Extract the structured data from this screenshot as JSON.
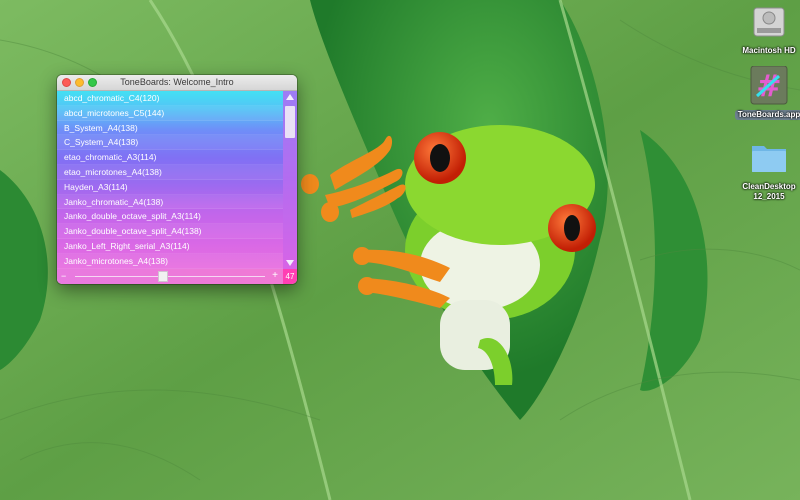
{
  "window": {
    "title": "ToneBoards: Welcome_Intro",
    "items": [
      "abcd_chromatic_C4(120)",
      "abcd_microtones_C5(144)",
      "B_System_A4(138)",
      "C_System_A4(138)",
      "etao_chromatic_A3(114)",
      "etao_microtones_A4(138)",
      "Hayden_A3(114)",
      "Janko_chromatic_A4(138)",
      "Janko_double_octave_split_A3(114)",
      "Janko_double_octave_split_A4(138)",
      "Janko_Left_Right_serial_A3(114)",
      "Janko_microtones_A4(138)"
    ],
    "counter": "47",
    "zoom_minus": "−",
    "zoom_plus": "+"
  },
  "desktop_icons": [
    {
      "name": "Macintosh HD",
      "icon": "hard-drive-icon"
    },
    {
      "name": "ToneBoards.app",
      "icon": "app-icon"
    },
    {
      "name": "CleanDesktop\n12_2015",
      "icon": "folder-icon"
    }
  ],
  "colors": {
    "leaf": "#6fa855",
    "list_top": "#43e0f3",
    "list_bottom": "#e86fe0",
    "counter_bg": "#ff3fb3"
  }
}
